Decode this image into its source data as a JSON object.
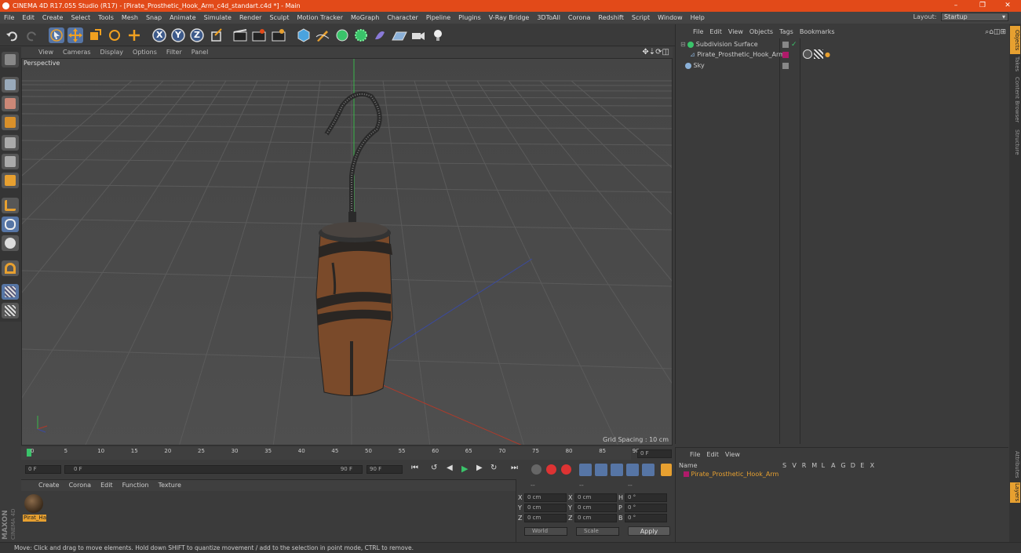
{
  "window": {
    "title": "CINEMA 4D R17.055 Studio (R17) - [Pirate_Prosthetic_Hook_Arm_c4d_standart.c4d *] - Main",
    "accent": "#e24a19",
    "buttons": [
      "–",
      "❐",
      "✕"
    ]
  },
  "menubar": {
    "items": [
      "File",
      "Edit",
      "Create",
      "Select",
      "Tools",
      "Mesh",
      "Snap",
      "Animate",
      "Simulate",
      "Render",
      "Sculpt",
      "Motion Tracker",
      "MoGraph",
      "Character",
      "Pipeline",
      "Plugins",
      "V-Ray Bridge",
      "3DToAll",
      "Corona",
      "Redshift",
      "Script",
      "Window",
      "Help"
    ],
    "layout_label": "Layout:",
    "layout_value": "Startup"
  },
  "toolbar": {
    "axis_labels": [
      "X",
      "Y",
      "Z"
    ]
  },
  "viewport": {
    "menu": [
      "View",
      "Cameras",
      "Display",
      "Options",
      "Filter",
      "Panel"
    ],
    "label": "Perspective",
    "grid_spacing": "Grid Spacing : 10 cm"
  },
  "timeline": {
    "ticks": [
      "0",
      "5",
      "10",
      "15",
      "20",
      "25",
      "30",
      "35",
      "40",
      "45",
      "50",
      "55",
      "60",
      "65",
      "70",
      "75",
      "80",
      "85",
      "90"
    ],
    "current_frame": "0 F",
    "start_frame": "0 F",
    "range_start": "0 F",
    "range_end": "90 F",
    "end_frame": "90 F"
  },
  "materials": {
    "menu": [
      "Create",
      "Corona",
      "Edit",
      "Function",
      "Texture"
    ],
    "items": [
      {
        "label": "Pirat_Ha"
      }
    ]
  },
  "coordinates": {
    "header": [
      "--",
      "--",
      "--"
    ],
    "rows": [
      {
        "a": "X",
        "av": "0 cm",
        "b": "X",
        "bv": "0 cm",
        "c": "H",
        "cv": "0 °"
      },
      {
        "a": "Y",
        "av": "0 cm",
        "b": "Y",
        "bv": "0 cm",
        "c": "P",
        "cv": "0 °"
      },
      {
        "a": "Z",
        "av": "0 cm",
        "b": "Z",
        "bv": "0 cm",
        "c": "B",
        "cv": "0 °"
      }
    ],
    "world": "World",
    "scale": "Scale",
    "apply": "Apply"
  },
  "objects": {
    "menu": [
      "File",
      "Edit",
      "View",
      "Objects",
      "Tags",
      "Bookmarks"
    ],
    "items": [
      {
        "name": "Subdivision Surface"
      },
      {
        "name": "Pirate_Prosthetic_Hook_Arm"
      },
      {
        "name": "Sky"
      }
    ]
  },
  "layers": {
    "menu": [
      "File",
      "Edit",
      "View"
    ],
    "name_header": "Name",
    "columns": [
      "S",
      "V",
      "R",
      "M",
      "L",
      "A",
      "G",
      "D",
      "E",
      "X"
    ],
    "rows": [
      {
        "name": "Pirate_Prosthetic_Hook_Arm"
      }
    ]
  },
  "right_tabs": [
    "Objects",
    "Takes",
    "Content Browser",
    "Structure",
    "Attributes",
    "Layers"
  ],
  "brand": {
    "line1": "MAXON",
    "line2": "CINEMA 4D"
  },
  "status": "Move: Click and drag to move elements. Hold down SHIFT to quantize movement / add to the selection in point mode, CTRL to remove."
}
